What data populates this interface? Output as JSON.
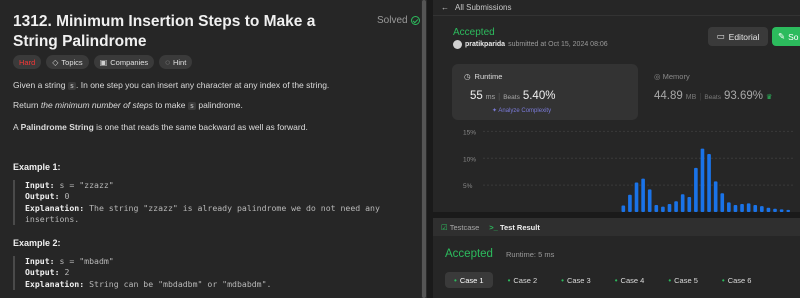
{
  "problem": {
    "title": "1312. Minimum Insertion Steps to Make a String Palindrome",
    "solved_label": "Solved",
    "tags": [
      "Hard",
      "Topics",
      "Companies",
      "Hint"
    ],
    "para1": [
      "Given a string ",
      "s",
      ". In one step you can insert any character at any index of the string."
    ],
    "para2": [
      "Return ",
      "the minimum number of steps",
      " to make ",
      "s",
      " palindrome."
    ],
    "para3": [
      "A ",
      "Palindrome String",
      " is one that reads the same backward as well as forward."
    ],
    "example1": {
      "title": "Example 1:",
      "lines": [
        {
          "k": "Input:",
          "v": " s = \"zzazz\""
        },
        {
          "k": "Output:",
          "v": " 0"
        },
        {
          "k": "Explanation:",
          "v": " The string \"zzazz\" is already palindrome we do not need any"
        },
        {
          "k": "",
          "v": "insertions."
        }
      ]
    },
    "example2": {
      "title": "Example 2:",
      "lines": [
        {
          "k": "Input:",
          "v": " s = \"mbadm\""
        },
        {
          "k": "Output:",
          "v": " 2"
        },
        {
          "k": "Explanation:",
          "v": " String can be \"mbdadbm\" or \"mdbabdm\"."
        }
      ]
    }
  },
  "submission": {
    "back_label": "All Submissions",
    "status": "Accepted",
    "user": "pratikparida",
    "submitted_text": "submitted at Oct 15, 2024 08:06",
    "editorial_label": "Editorial",
    "solution_label": "So",
    "runtime": {
      "label": "Runtime",
      "value": "55",
      "unit": "ms",
      "beats_label": "Beats",
      "beats": "5.40%",
      "analyze": "Analyze Complexity"
    },
    "memory": {
      "label": "Memory",
      "value": "44.89",
      "unit": "MB",
      "beats_label": "Beats",
      "beats": "93.69%"
    }
  },
  "chart_data": {
    "type": "bar",
    "title": "",
    "xlabel": "",
    "ylabel": "",
    "ylim": [
      0,
      16
    ],
    "yticks": [
      "15%",
      "10%",
      "5%"
    ],
    "ytick_values": [
      15,
      10,
      5
    ],
    "values": [
      0,
      0,
      0,
      0,
      0,
      0,
      0,
      0,
      0,
      0,
      0,
      0,
      0,
      0,
      0,
      0,
      0,
      0,
      0,
      0,
      0,
      1.2,
      3.2,
      5.5,
      6.2,
      4.2,
      1.3,
      1.0,
      1.5,
      2.0,
      3.3,
      2.8,
      8.2,
      11.8,
      10.8,
      5.7,
      3.5,
      1.8,
      1.3,
      1.5,
      1.6,
      1.3,
      1.1,
      0.8,
      0.6,
      0.5,
      0.4
    ],
    "highlight_color": "#1e88e5",
    "bar_color": "#1a73e8"
  },
  "testresult": {
    "tab1": "Testcase",
    "tab2": "Test Result",
    "status": "Accepted",
    "runtime_text": "Runtime: 5 ms",
    "cases": [
      "Case 1",
      "Case 2",
      "Case 3",
      "Case 4",
      "Case 5",
      "Case 6"
    ]
  }
}
